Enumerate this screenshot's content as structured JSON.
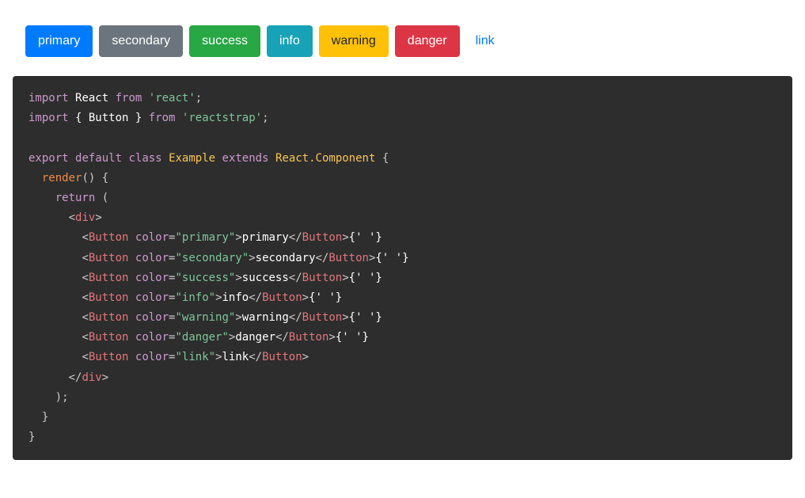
{
  "buttons": {
    "primary": "primary",
    "secondary": "secondary",
    "success": "success",
    "info": "info",
    "warning": "warning",
    "danger": "danger",
    "link": "link"
  },
  "code": {
    "kw_import1": "import",
    "react": "React",
    "kw_from1": "from",
    "str_react": "'react'",
    "semi1": ";",
    "kw_import2": "import",
    "button_destruct": "{ Button }",
    "kw_from2": "from",
    "str_reactstrap": "'reactstrap'",
    "semi2": ";",
    "kw_export": "export",
    "kw_default": "default",
    "kw_class": "class",
    "cls_example": "Example",
    "kw_extends": "extends",
    "react_component": "React.Component",
    "brace_open1": " {",
    "fn_render": "render",
    "render_parens": "()",
    "brace_open2": " {",
    "kw_return": "return",
    "paren_open": " (",
    "lt1": "<",
    "tag_div": "div",
    "gt1": ">",
    "lt_b1": "<",
    "tag_button1": "Button",
    "attr_color1": "color",
    "eq1": "=",
    "val_primary": "\"primary\"",
    "gt_b1": ">",
    "txt_primary": "primary",
    "ltc_b1": "</",
    "tag_button1c": "Button",
    "gtc_b1": ">",
    "space1": "{' '}",
    "lt_b2": "<",
    "tag_button2": "Button",
    "attr_color2": "color",
    "eq2": "=",
    "val_secondary": "\"secondary\"",
    "gt_b2": ">",
    "txt_secondary": "secondary",
    "ltc_b2": "</",
    "tag_button2c": "Button",
    "gtc_b2": ">",
    "space2": "{' '}",
    "lt_b3": "<",
    "tag_button3": "Button",
    "attr_color3": "color",
    "eq3": "=",
    "val_success": "\"success\"",
    "gt_b3": ">",
    "txt_success": "success",
    "ltc_b3": "</",
    "tag_button3c": "Button",
    "gtc_b3": ">",
    "space3": "{' '}",
    "lt_b4": "<",
    "tag_button4": "Button",
    "attr_color4": "color",
    "eq4": "=",
    "val_info": "\"info\"",
    "gt_b4": ">",
    "txt_info": "info",
    "ltc_b4": "</",
    "tag_button4c": "Button",
    "gtc_b4": ">",
    "space4": "{' '}",
    "lt_b5": "<",
    "tag_button5": "Button",
    "attr_color5": "color",
    "eq5": "=",
    "val_warning": "\"warning\"",
    "gt_b5": ">",
    "txt_warning": "warning",
    "ltc_b5": "</",
    "tag_button5c": "Button",
    "gtc_b5": ">",
    "space5": "{' '}",
    "lt_b6": "<",
    "tag_button6": "Button",
    "attr_color6": "color",
    "eq6": "=",
    "val_danger": "\"danger\"",
    "gt_b6": ">",
    "txt_danger": "danger",
    "ltc_b6": "</",
    "tag_button6c": "Button",
    "gtc_b6": ">",
    "space6": "{' '}",
    "lt_b7": "<",
    "tag_button7": "Button",
    "attr_color7": "color",
    "eq7": "=",
    "val_link": "\"link\"",
    "gt_b7": ">",
    "txt_link": "link",
    "ltc_b7": "</",
    "tag_button7c": "Button",
    "gtc_b7": ">",
    "ltc_div": "</",
    "tag_divc": "div",
    "gtc_div": ">",
    "paren_close": ");",
    "brace_close2": "}",
    "brace_close1": "}"
  }
}
